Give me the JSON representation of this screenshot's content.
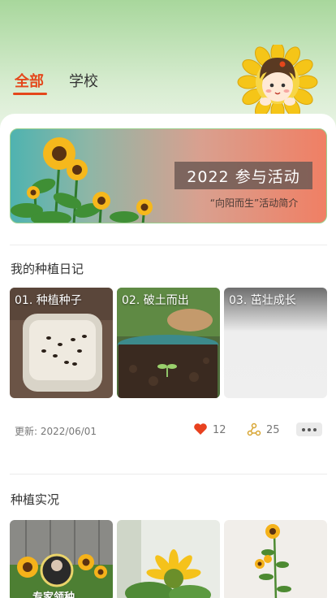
{
  "tabs": [
    {
      "label": "全部"
    },
    {
      "label": "学校"
    }
  ],
  "banner": {
    "title": "2022 参与活动",
    "subtitle": "“向阳而生”活动简介"
  },
  "diary": {
    "section_title": "我的种植日记",
    "cards": [
      {
        "label": "01. 种植种子"
      },
      {
        "label": "02. 破土而出"
      },
      {
        "label": "03. 茁壮成长"
      }
    ],
    "update_text": "更新: 2022/06/01",
    "likes": "12",
    "shares": "25"
  },
  "live": {
    "section_title": "种植实况",
    "expert_label": "专家领种"
  },
  "colors": {
    "accent": "#e4471b",
    "like": "#e8411f",
    "share": "#d8a532"
  }
}
